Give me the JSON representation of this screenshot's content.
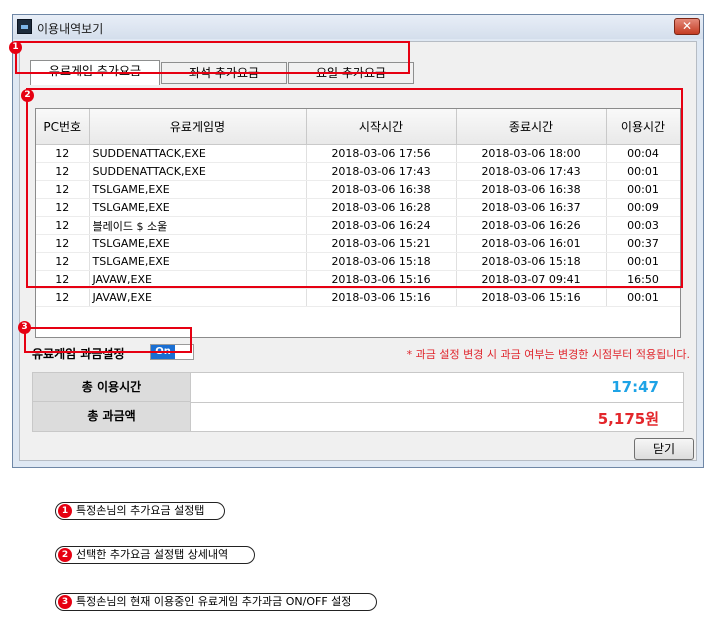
{
  "window": {
    "title": "이용내역보기",
    "close_glyph": "✕"
  },
  "tabs": [
    {
      "label": "유료게임 추가요금",
      "active": true
    },
    {
      "label": "좌석 추가요금",
      "active": false
    },
    {
      "label": "요일 추가요금",
      "active": false
    }
  ],
  "table": {
    "columns": [
      "PC번호",
      "유료게임명",
      "시작시간",
      "종료시간",
      "이용시간"
    ],
    "rows": [
      [
        "12",
        "SUDDENATTACK,EXE",
        "2018-03-06 17:56",
        "2018-03-06 18:00",
        "00:04"
      ],
      [
        "12",
        "SUDDENATTACK,EXE",
        "2018-03-06 17:43",
        "2018-03-06 17:43",
        "00:01"
      ],
      [
        "12",
        "TSLGAME,EXE",
        "2018-03-06 16:38",
        "2018-03-06 16:38",
        "00:01"
      ],
      [
        "12",
        "TSLGAME,EXE",
        "2018-03-06 16:28",
        "2018-03-06 16:37",
        "00:09"
      ],
      [
        "12",
        "블레이드 $ 소울",
        "2018-03-06 16:24",
        "2018-03-06 16:26",
        "00:03"
      ],
      [
        "12",
        "TSLGAME,EXE",
        "2018-03-06 15:21",
        "2018-03-06 16:01",
        "00:37"
      ],
      [
        "12",
        "TSLGAME,EXE",
        "2018-03-06 15:18",
        "2018-03-06 15:18",
        "00:01"
      ],
      [
        "12",
        "JAVAW,EXE",
        "2018-03-06 15:16",
        "2018-03-07 09:41",
        "16:50"
      ],
      [
        "12",
        "JAVAW,EXE",
        "2018-03-06 15:16",
        "2018-03-06 15:16",
        "00:01"
      ]
    ]
  },
  "billing": {
    "label": "유료게임 과금설정",
    "toggle_label": "On",
    "notice": "* 과금 설정 변경 시 과금 여부는 변경한 시점부터 적용됩니다."
  },
  "summary": {
    "total_time_label": "총 이용시간",
    "total_time_value": "17:47",
    "total_fee_label": "총 과금액",
    "total_fee_value": "5,175원"
  },
  "buttons": {
    "close_label": "닫기"
  },
  "callouts": {
    "badges": [
      "1",
      "2",
      "3"
    ],
    "notes": [
      "특정손님의 추가요금 설정탭",
      "선택한 추가요금 설정탭 상세내역",
      "특정손님의 현재 이용중인  유료게임 추가과금 ON/OFF 설정"
    ]
  },
  "colors": {
    "highlight": "#e60012",
    "time_value": "#1ea3e6",
    "fee_value": "#e3262b",
    "toggle_on": "#1a6fd3"
  }
}
